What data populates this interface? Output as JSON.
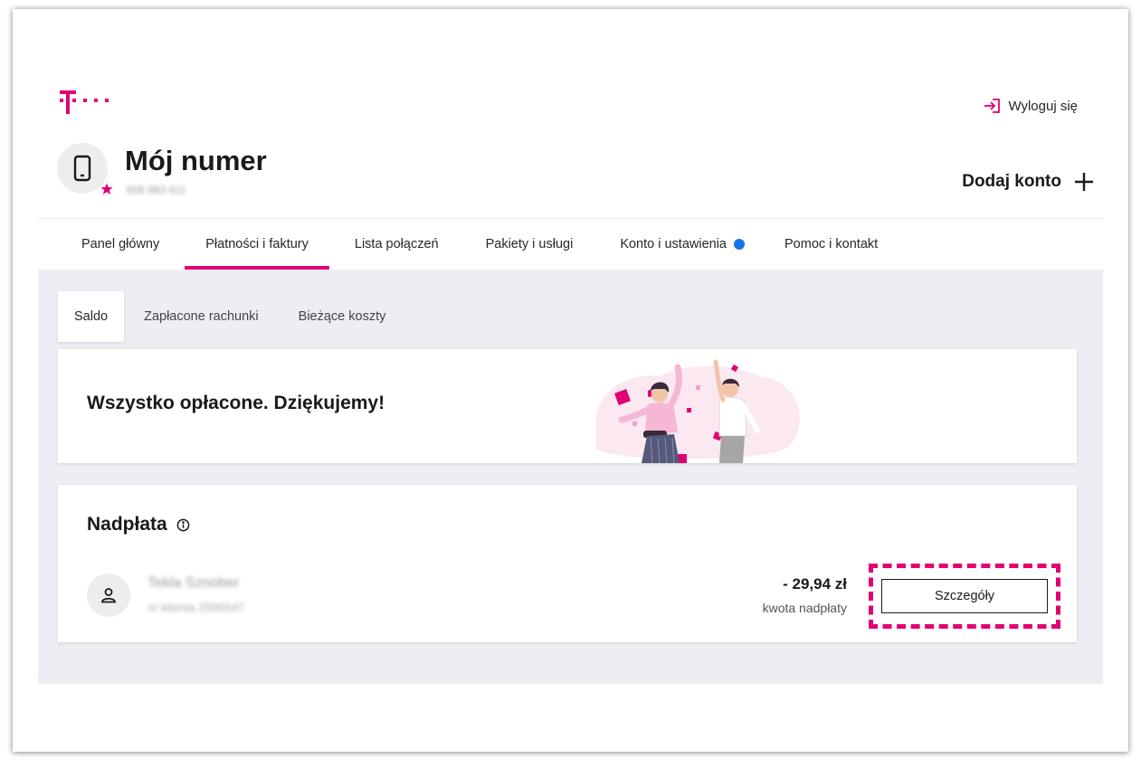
{
  "header": {
    "logo_icon": "telekom-t-logo",
    "logout_label": "Wyloguj się",
    "title": "Mój numer",
    "phone_number": "606 883 611",
    "add_account_label": "Dodaj konto"
  },
  "nav": {
    "items": [
      {
        "label": "Panel główny",
        "active": false
      },
      {
        "label": "Płatności i faktury",
        "active": true
      },
      {
        "label": "Lista połączeń",
        "active": false
      },
      {
        "label": "Pakiety i usługi",
        "active": false
      },
      {
        "label": "Konto i ustawienia",
        "active": false,
        "badge": true
      },
      {
        "label": "Pomoc i kontakt",
        "active": false
      }
    ]
  },
  "subtabs": [
    {
      "label": "Saldo",
      "active": true
    },
    {
      "label": "Zapłacone rachunki",
      "active": false
    },
    {
      "label": "Bieżące koszty",
      "active": false
    }
  ],
  "paid_card": {
    "message": "Wszystko opłacone. Dziękujemy!"
  },
  "overpayment": {
    "title": "Nadpłata",
    "customer_name": "Tekla Sznober",
    "customer_id": "nr klienta 2595547",
    "amount": "- 29,94 zł",
    "amount_label": "kwota nadpłaty",
    "details_label": "Szczegóły"
  },
  "colors": {
    "brand": "#e20074",
    "badge": "#1a73e8",
    "content_bg": "#eeedf3"
  }
}
